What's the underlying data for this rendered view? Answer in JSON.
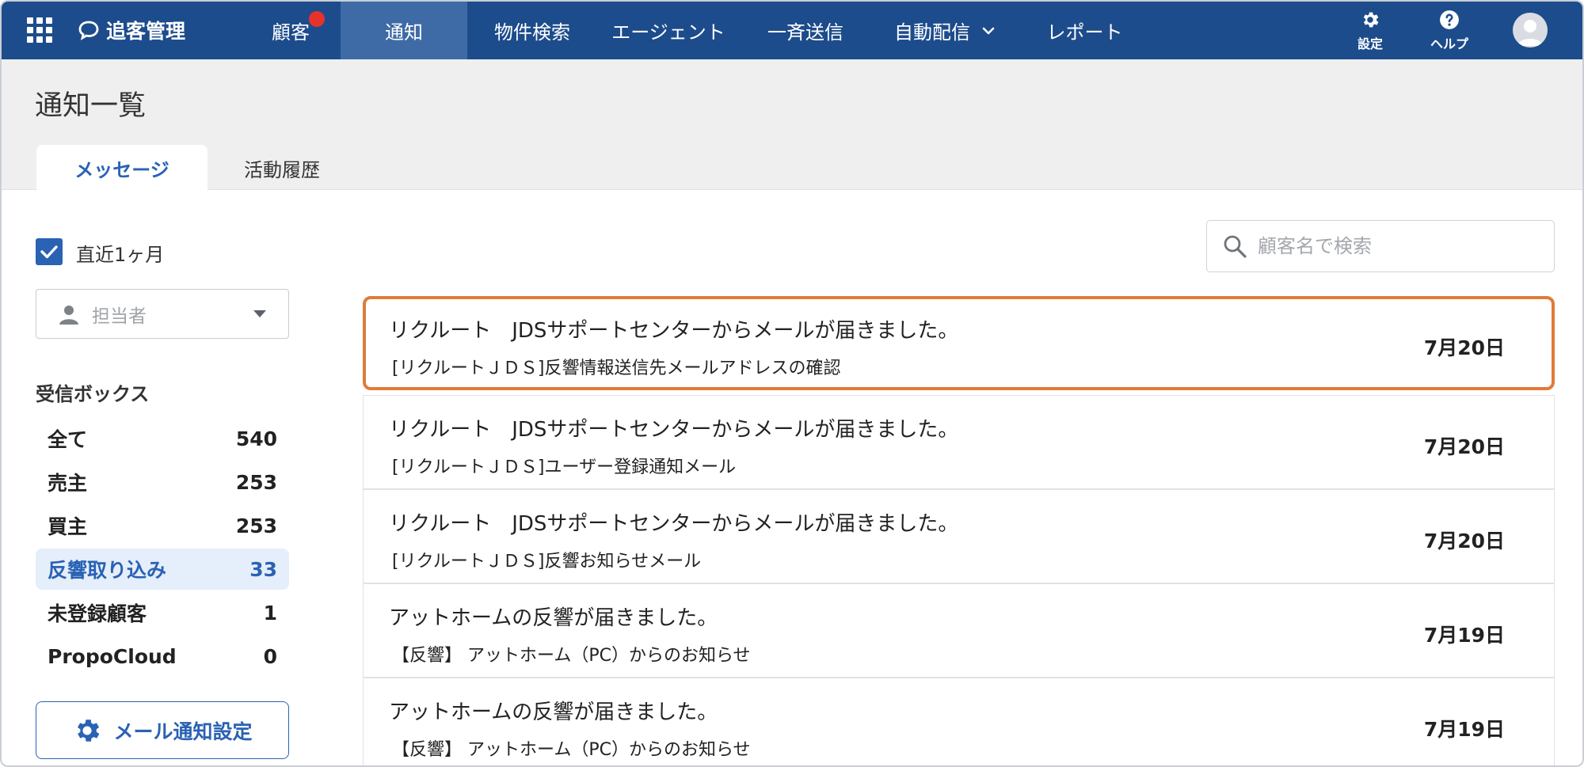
{
  "nav": {
    "brand": "追客管理",
    "items": [
      {
        "label": "顧客",
        "badge": true
      },
      {
        "label": "通知",
        "active": true
      },
      {
        "label": "物件検索"
      },
      {
        "label": "エージェント"
      },
      {
        "label": "一斉送信"
      },
      {
        "label": "自動配信",
        "dropdown": true
      },
      {
        "label": "レポート"
      }
    ],
    "settings_label": "設定",
    "help_label": "ヘルプ"
  },
  "page": {
    "title": "通知一覧",
    "tabs": [
      {
        "label": "メッセージ",
        "active": true
      },
      {
        "label": "活動履歴",
        "active": false
      }
    ]
  },
  "filters": {
    "recent_label": "直近1ヶ月",
    "recent_checked": true,
    "assignee_placeholder": "担当者"
  },
  "inbox": {
    "title": "受信ボックス",
    "items": [
      {
        "label": "全て",
        "count": "540"
      },
      {
        "label": "売主",
        "count": "253"
      },
      {
        "label": "買主",
        "count": "253"
      },
      {
        "label": "反響取り込み",
        "count": "33",
        "active": true
      },
      {
        "label": "未登録顧客",
        "count": "1"
      },
      {
        "label": "PropoCloud",
        "count": "0"
      }
    ],
    "settings_button": "メール通知設定"
  },
  "search": {
    "placeholder": "顧客名で検索"
  },
  "messages": [
    {
      "title": "リクルート　JDSサポートセンターからメールが届きました。",
      "subject": "[リクルートＪＤＳ]反響情報送信先メールアドレスの確認",
      "date": "7月20日",
      "highlighted": true
    },
    {
      "title": "リクルート　JDSサポートセンターからメールが届きました。",
      "subject": "[リクルートＪＤＳ]ユーザー登録通知メール",
      "date": "7月20日"
    },
    {
      "title": "リクルート　JDSサポートセンターからメールが届きました。",
      "subject": "[リクルートＪＤＳ]反響お知らせメール",
      "date": "7月20日"
    },
    {
      "title": "アットホームの反響が届きました。",
      "subject": "【反響】 アットホーム（PC）からのお知らせ",
      "date": "7月19日"
    },
    {
      "title": "アットホームの反響が届きました。",
      "subject": "【反響】 アットホーム（PC）からのお知らせ",
      "date": "7月19日"
    }
  ],
  "colors": {
    "nav_bg": "#1d4c8c",
    "nav_active": "#3e6ba6",
    "accent": "#2a62b4",
    "badge": "#e5322b",
    "highlight_border": "#e07b39"
  }
}
